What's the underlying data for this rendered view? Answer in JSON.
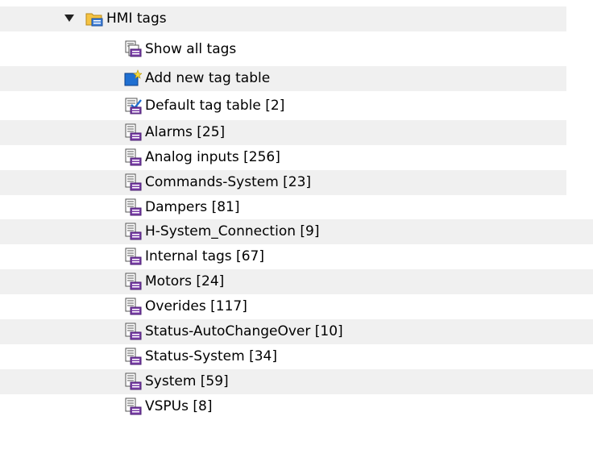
{
  "tree": {
    "root": {
      "label": "HMI tags",
      "icon": "folder-icon",
      "expanded": true
    },
    "items": [
      {
        "label": "Show all tags",
        "icon": "show-all-tags-icon"
      },
      {
        "label": "Add new tag table",
        "icon": "add-new-icon"
      },
      {
        "label": "Default tag table [2]",
        "icon": "default-tag-table-icon"
      },
      {
        "label": "Alarms [25]",
        "icon": "tag-table-icon"
      },
      {
        "label": "Analog inputs [256]",
        "icon": "tag-table-icon"
      },
      {
        "label": "Commands-System [23]",
        "icon": "tag-table-icon"
      },
      {
        "label": "Dampers [81]",
        "icon": "tag-table-icon"
      },
      {
        "label": "H-System_Connection [9]",
        "icon": "tag-table-icon"
      },
      {
        "label": "Internal tags [67]",
        "icon": "tag-table-icon"
      },
      {
        "label": "Motors [24]",
        "icon": "tag-table-icon"
      },
      {
        "label": "Overides [117]",
        "icon": "tag-table-icon"
      },
      {
        "label": "Status-AutoChangeOver [10]",
        "icon": "tag-table-icon"
      },
      {
        "label": "Status-System [34]",
        "icon": "tag-table-icon"
      },
      {
        "label": "System [59]",
        "icon": "tag-table-icon"
      },
      {
        "label": "VSPUs [8]",
        "icon": "tag-table-icon"
      }
    ]
  },
  "colors": {
    "row_alt": "#f0f0f0",
    "icon_blue": "#1f6fd1",
    "icon_purple": "#7b3fa8",
    "folder_yellow": "#f5c342"
  }
}
